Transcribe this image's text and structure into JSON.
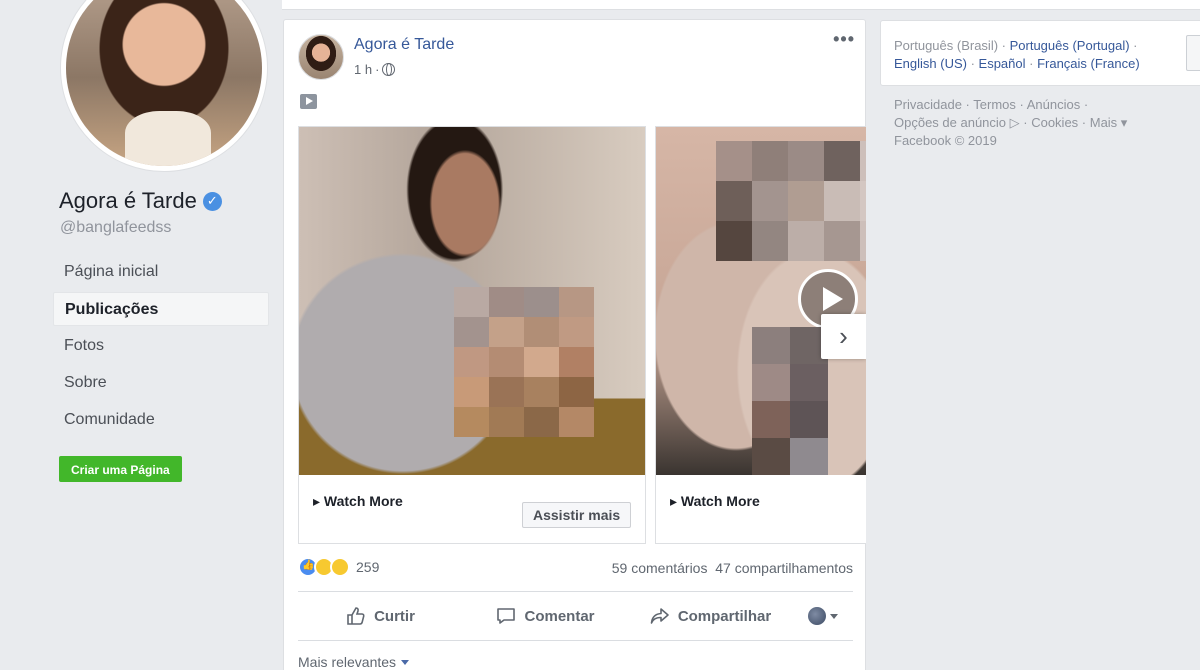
{
  "page": {
    "name": "Agora é Tarde",
    "handle": "@banglafeedss",
    "verified_mark": "✓"
  },
  "left_nav": {
    "items": [
      {
        "label": "Página inicial",
        "active": false
      },
      {
        "label": "Publicações",
        "active": true
      },
      {
        "label": "Fotos",
        "active": false
      },
      {
        "label": "Sobre",
        "active": false
      },
      {
        "label": "Comunidade",
        "active": false
      }
    ],
    "create_page_label": "Criar uma Página"
  },
  "post": {
    "author": "Agora é Tarde",
    "time": "1 h",
    "separator": "·",
    "more_label": "•••",
    "cards": [
      {
        "caption": "▸ Watch More",
        "button": "Assistir mais"
      },
      {
        "caption": "▸ Watch More"
      }
    ],
    "next_arrow": "›",
    "reaction_count": "259",
    "comments": "59 comentários",
    "shares": "47 compartilhamentos",
    "actions": {
      "like": "Curtir",
      "comment": "Comentar",
      "share": "Compartilhar"
    },
    "sort_label": "Mais relevantes"
  },
  "languages": {
    "current": "Português (Brasil)",
    "others": [
      "Português (Portugal)",
      "English (US)",
      "Español",
      "Français (France)"
    ]
  },
  "footer": {
    "links": [
      "Privacidade",
      "Termos",
      "Anúncios",
      "Opções de anúncio ▷",
      "Cookies",
      "Mais ▾"
    ],
    "copyright": "Facebook © 2019"
  },
  "colors": {
    "link": "#365899",
    "green": "#42b72a",
    "background": "#e9ebee",
    "verified": "#4a90e2"
  },
  "icons": [
    "verified-icon",
    "globe-icon",
    "video-icon",
    "like-icon",
    "comment-icon",
    "share-icon",
    "chevron-right-icon",
    "caret-down-icon"
  ]
}
